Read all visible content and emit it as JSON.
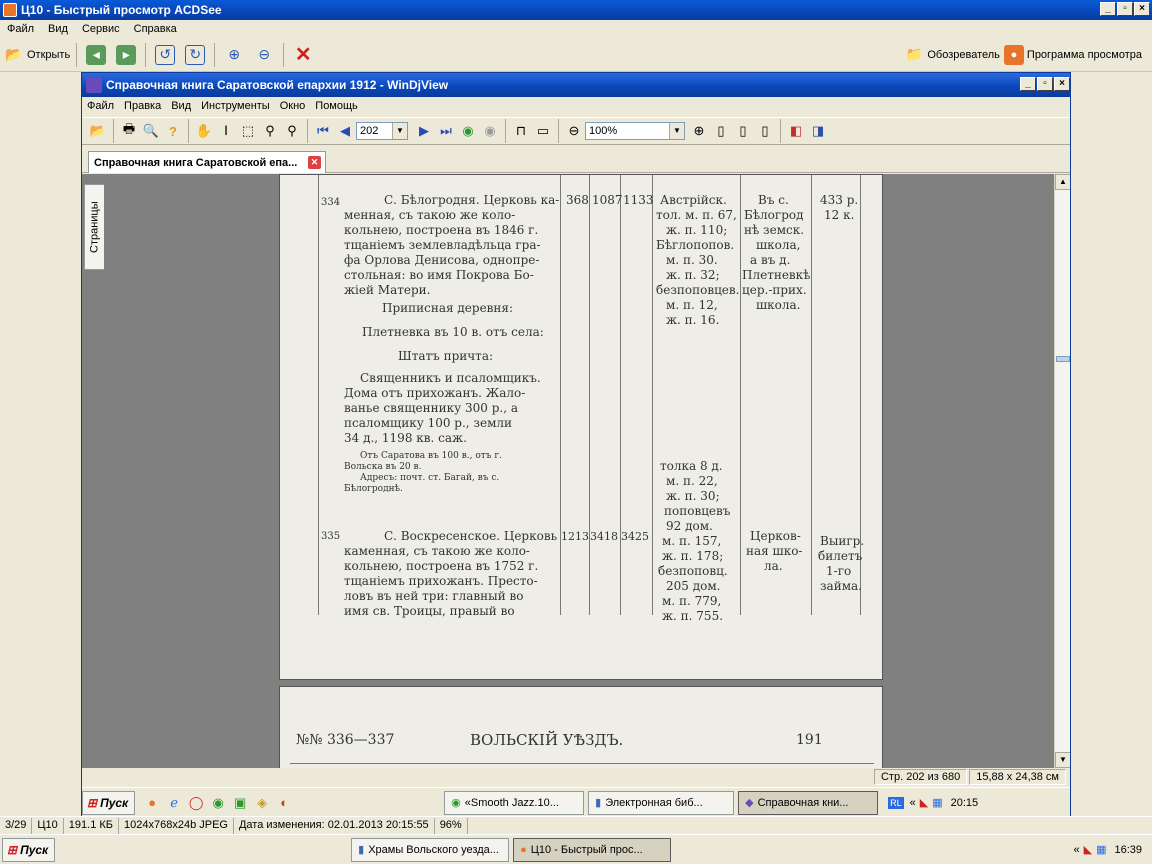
{
  "acdsee": {
    "title": "Ц10 - Быстрый просмотр ACDSee",
    "menu": [
      "Файл",
      "Вид",
      "Сервис",
      "Справка"
    ],
    "toolbar": {
      "open_label": "Открыть",
      "browser_label": "Обозреватель",
      "viewer_label": "Программа просмотра"
    }
  },
  "windjview": {
    "title": "Справочная книга Саратовской епархии 1912 - WinDjView",
    "menu": [
      "Файл",
      "Правка",
      "Вид",
      "Инструменты",
      "Окно",
      "Помощь"
    ],
    "page_number": "202",
    "zoom": "100%",
    "tab_label": "Справочная книга Саратовской епа...",
    "side_tab": "Страницы",
    "status": {
      "page": "Стр. 202 из 680",
      "size": "15,88 x 24,38 см"
    }
  },
  "document": {
    "e334": {
      "num": "334",
      "lines": [
        "С. Бѣлогродня. Церковь ка-",
        "менная, съ такою же коло-",
        "кольнею, построена въ 1846 г.",
        "тщаніемъ землевладѣльца гра-",
        "фа Орлова Денисова, однопре-",
        "стольная: во имя Покрова Бо-",
        "жіей Матери."
      ],
      "nums": [
        "368",
        "1087",
        "1133"
      ],
      "col4": [
        "Австрійск.",
        "тол. м. п. 67,",
        "ж. п. 110;",
        "Бѣглопопов.",
        "м. п. 30.",
        "ж. п. 32;",
        "безпоповцев.",
        "м. п. 12,",
        "ж. п. 16."
      ],
      "col5": [
        "Въ с.",
        "Бѣлогрод",
        "нѣ земск.",
        "школа,",
        "а въ д.",
        "Плетневкѣ",
        "цер.-прих.",
        "школа."
      ],
      "col6": [
        "433 р.",
        "12 к."
      ],
      "pripis_head": "Приписная деревня:",
      "pripis": "Плетневка въ 10 в. отъ села:",
      "shtat_head": "Штатъ причта:",
      "shtat": [
        "Священникъ и псаломщикъ.",
        "Дома отъ прихожанъ. Жало-",
        "ванье священнику 300 р., а",
        "псаломщику 100 р., земли",
        "34 д., 1198 кв. саж."
      ],
      "small": [
        "Отъ Саратова въ 100 в., отъ г.",
        "Вольска въ 20 в.",
        "Адресъ: почт. ст. Багай, въ с.",
        "Бѣлогроднѣ."
      ]
    },
    "e335": {
      "num": "335",
      "lines": [
        "С. Воскресенское. Церковь",
        "каменная, съ такою же коло-",
        "кольнею, построена въ 1752 г.",
        "тщаніемъ прихожанъ. Престо-",
        "ловъ въ ней три: главный во",
        "имя св. Троицы, правый во"
      ],
      "nums": [
        "1213",
        "3418",
        "3425"
      ],
      "col4": [
        "толка 8 д.",
        "м. п. 22,",
        "ж. п. 30;",
        "поповцевъ",
        "92 дом.",
        "м. п. 157,",
        "ж. п. 178;",
        "безпоповц.",
        "205 дом.",
        "м. п. 779,",
        "ж. п. 755."
      ],
      "col5": [
        "Церков-",
        "ная шко-",
        "ла."
      ],
      "col6": [
        "Выигр.",
        "билетъ",
        "1-го",
        "займа."
      ]
    },
    "next_page": {
      "left": "№№ 336—337",
      "center": "ВОЛЬСКІЙ УѢЗДЪ.",
      "right": "191"
    }
  },
  "inner_taskbar": {
    "start": "Пуск",
    "tasks": [
      "«Smooth Jazz.10...",
      "Электронная биб...",
      "Справочная кни..."
    ],
    "lang": "RL",
    "time": "20:15"
  },
  "acdsee_status": {
    "index": "3/29",
    "name": "Ц10",
    "size": "191.1 КБ",
    "dims": "1024x768x24b JPEG",
    "modified": "Дата изменения: 02.01.2013 20:15:55",
    "zoom": "96%"
  },
  "outer_taskbar": {
    "start": "Пуск",
    "tasks": [
      "Храмы Вольского уезда...",
      "Ц10 - Быстрый прос..."
    ],
    "time": "16:39"
  }
}
